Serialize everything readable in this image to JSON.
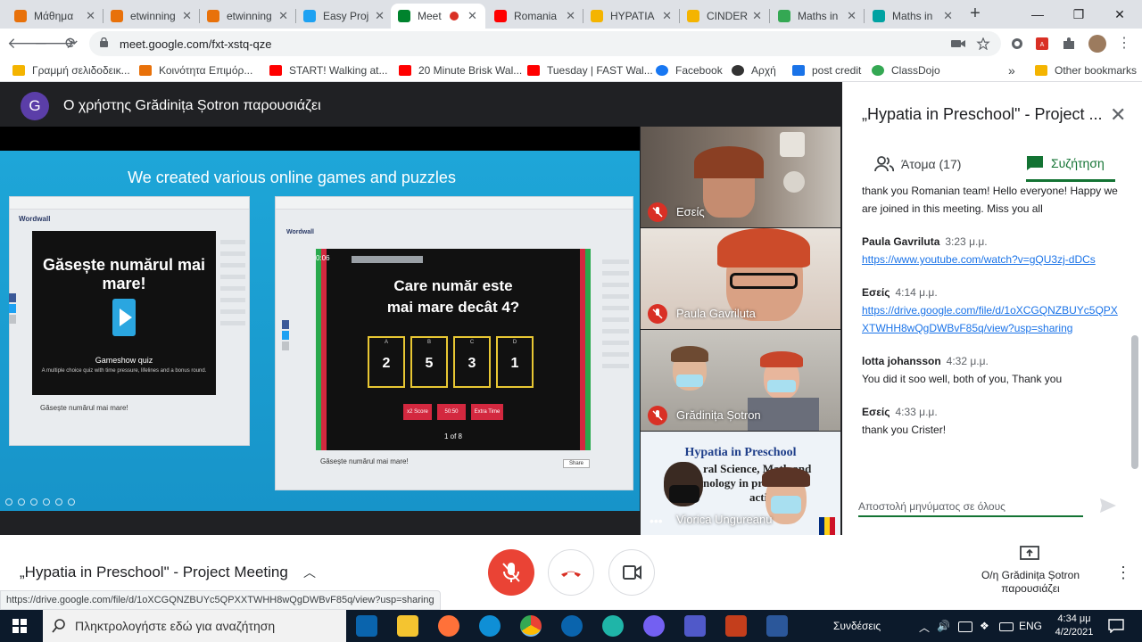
{
  "browser": {
    "tabs": [
      {
        "label": "Μάθημα",
        "fav_color": "#e8710a",
        "icon": "moodle-icon"
      },
      {
        "label": "etwinning",
        "fav_color": "#e8710a",
        "icon": "moodle-icon"
      },
      {
        "label": "etwinning",
        "fav_color": "#e8710a",
        "icon": "moodle-icon"
      },
      {
        "label": "Easy Proj",
        "fav_color": "#1da1f2",
        "icon": "easy-icon"
      },
      {
        "label": "Meet",
        "fav_color": "#00832d",
        "icon": "meet-icon",
        "active": true
      },
      {
        "label": "Romania",
        "fav_color": "#ff0000",
        "icon": "youtube-icon"
      },
      {
        "label": "HYPATIA",
        "fav_color": "#f4b400",
        "icon": "drive-icon"
      },
      {
        "label": "CINDERE",
        "fav_color": "#f4b400",
        "icon": "slides-icon"
      },
      {
        "label": "Maths in",
        "fav_color": "#34a853",
        "icon": "drive-icon"
      },
      {
        "label": "Maths in",
        "fav_color": "#00a2a2",
        "icon": "sway-icon"
      }
    ],
    "new_tab_label": "+",
    "window_controls": {
      "minimize": "—",
      "maximize": "❐",
      "close": "✕"
    },
    "url": "meet.google.com/fxt-xstq-qze",
    "bookmarks": [
      {
        "label": "Γραμμή σελιδοδεικ...",
        "icon": "folder-icon",
        "color": "#f4b400"
      },
      {
        "label": "Κοινότητα Επιμόρ...",
        "icon": "moodle-icon",
        "color": "#e8710a"
      },
      {
        "label": "START! Walking at...",
        "icon": "youtube-icon",
        "color": "#ff0000"
      },
      {
        "label": "20 Minute Brisk Wal...",
        "icon": "youtube-icon",
        "color": "#ff0000"
      },
      {
        "label": "Tuesday | FAST Wal...",
        "icon": "youtube-icon",
        "color": "#ff0000"
      },
      {
        "label": "Facebook",
        "icon": "facebook-icon",
        "color": "#1877f2"
      },
      {
        "label": "Αρχή",
        "icon": "gear-icon",
        "color": "#333333"
      },
      {
        "label": "post credit",
        "icon": "pc-icon",
        "color": "#1a73e8"
      },
      {
        "label": "ClassDojo",
        "icon": "classdojo-icon",
        "color": "#34a853"
      }
    ],
    "bookmarks_more": "»",
    "other_bookmarks": "Other bookmarks"
  },
  "presentation": {
    "avatar_letter": "G",
    "presenter_title": "Ο χρήστης Grădinița Șotron παρουσιάζει",
    "slide": {
      "heading": "We created various online games and puzzles",
      "left_game": {
        "brand": "Wordwall",
        "title": "Găsește numărul mai mare!",
        "mode": "Gameshow quiz",
        "mode_desc": "A multiple choice quiz with time pressure, lifelines and a bonus round.",
        "caption": "Găsește numărul mai mare!"
      },
      "right_game": {
        "brand": "Wordwall",
        "timer": "0:06",
        "question_line1": "Care număr este",
        "question_line2": "mai mare decât 4?",
        "answers": [
          {
            "letter": "A",
            "value": "2"
          },
          {
            "letter": "B",
            "value": "5"
          },
          {
            "letter": "C",
            "value": "3"
          },
          {
            "letter": "D",
            "value": "1"
          }
        ],
        "lifelines": [
          "x2 Score",
          "50:50",
          "Extra Time"
        ],
        "counter": "1 of 8",
        "caption": "Găsește numărul mai mare!",
        "share_label": "Share"
      }
    }
  },
  "participants": [
    {
      "name": "Εσείς",
      "muted": true,
      "bg": "#7d6f64"
    },
    {
      "name": "Paula Gavriluta",
      "muted": true,
      "bg": "#b37a5d"
    },
    {
      "name": "Grădinița Șotron",
      "muted": true,
      "bg": "#8f8a83"
    },
    {
      "name": "Viorica Ungureanu",
      "muted": false,
      "bg": "#e8eef5"
    }
  ],
  "participant_poster": {
    "line1": "Hypatia in Preschool",
    "line2": "ral Science, Math and",
    "line3": "nology in pr    ol",
    "line4": "activiti"
  },
  "chat": {
    "title": "„Hypatia in Preschool\" - Project ...",
    "tab_people": "Άτομα (17)",
    "tab_chat": "Συζήτηση",
    "first_body": "thank you Romanian team! Hello everyone! Happy we are joined in this meeting. Miss you all",
    "messages": [
      {
        "sender": "Paula Gavriluta",
        "time": "3:23 μ.μ.",
        "body": "https://www.youtube.com/watch?v=gQU3zj-dDCs",
        "is_link": true
      },
      {
        "sender": "Εσείς",
        "time": "4:14 μ.μ.",
        "body": "https://drive.google.com/file/d/1oXCGQNZBUYc5QPXXTWHH8wQgDWBvF85q/view?usp=sharing",
        "is_link": true
      },
      {
        "sender": "lotta johansson",
        "time": "4:32 μ.μ.",
        "body": "You did it soo well, both of you, Thank you",
        "is_link": false
      },
      {
        "sender": "Εσείς",
        "time": "4:33 μ.μ.",
        "body": "thank you Crister!",
        "is_link": false
      }
    ],
    "input_placeholder": "Αποστολή μηνύματος σε όλους"
  },
  "controls": {
    "meeting_name": "„Hypatia in Preschool\" - Project Meeting",
    "presenting_line1": "Ο/η Grădinița Șotron",
    "presenting_line2": "παρουσιάζει",
    "colors": {
      "end_call": "#d93025",
      "mic_off": "#ea4335",
      "accent": "#137333"
    }
  },
  "status_url": "https://drive.google.com/file/d/1oXCGQNZBUYc5QPXXTWHH8wQgDWBvF85q/view?usp=sharing",
  "taskbar": {
    "search_placeholder": "Πληκτρολογήστε εδώ για αναζήτηση",
    "tray_label": "Συνδέσεις",
    "language": "ENG",
    "time": "4:34 μμ",
    "date": "4/2/2021",
    "apps": [
      {
        "name": "mail-icon",
        "color": "#0a64ad"
      },
      {
        "name": "file-explorer-icon",
        "color": "#f4c430"
      },
      {
        "name": "firefox-icon",
        "color": "#ff7139"
      },
      {
        "name": "edge-icon",
        "color": "#0f8fd6"
      },
      {
        "name": "chrome-icon",
        "color": "#4285f4"
      },
      {
        "name": "outlook-icon",
        "color": "#0a64ad"
      },
      {
        "name": "app-teal-icon",
        "color": "#1fb5a8"
      },
      {
        "name": "viber-icon",
        "color": "#7360f2"
      },
      {
        "name": "teams-icon",
        "color": "#5059c9"
      },
      {
        "name": "powerpoint-icon",
        "color": "#c43e1c"
      },
      {
        "name": "word-icon",
        "color": "#2b579a"
      }
    ]
  }
}
